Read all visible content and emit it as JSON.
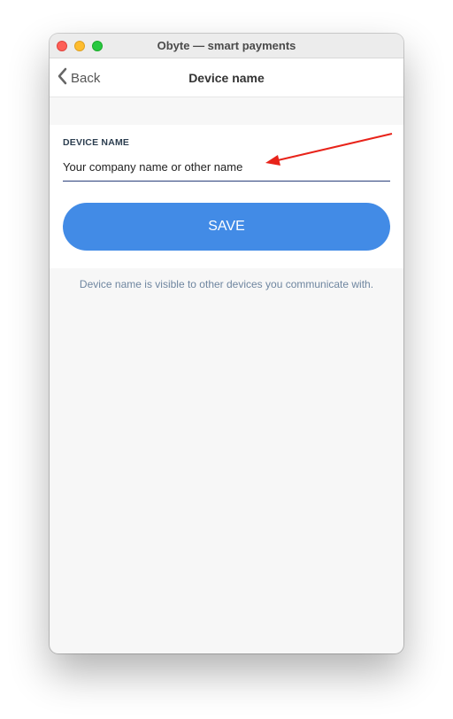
{
  "window": {
    "title": "Obyte — smart payments"
  },
  "navbar": {
    "back_label": "Back",
    "title": "Device name"
  },
  "form": {
    "label": "DEVICE NAME",
    "input_value": "Your company name or other name",
    "save_label": "SAVE"
  },
  "help_text": "Device name is visible to other devices you communicate with.",
  "icons": {
    "back": "chevron-left-icon",
    "annotation": "red-arrow"
  },
  "colors": {
    "accent": "#428be6",
    "annotation": "#e8231a",
    "label": "#2c3e50",
    "help_text": "#6f86a0",
    "input_underline": "#2a3f7a"
  }
}
